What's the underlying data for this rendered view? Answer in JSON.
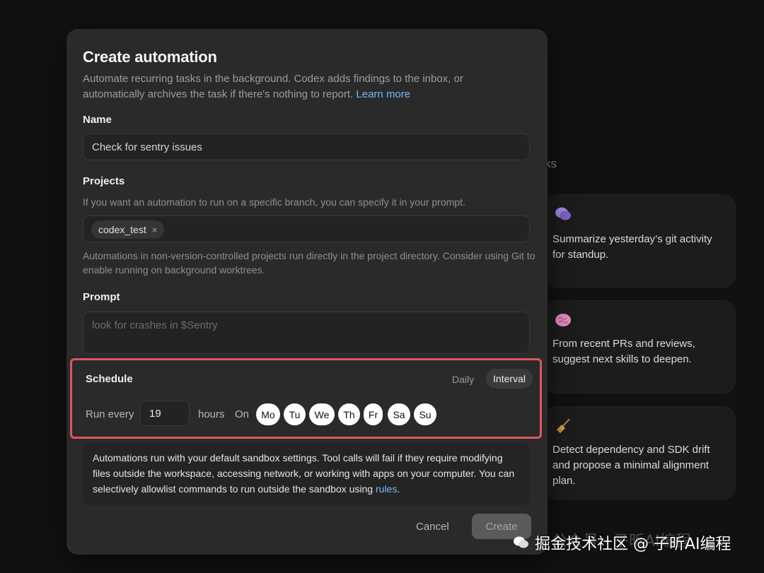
{
  "background": {
    "heading_partial": "ks",
    "cards": [
      {
        "icon": "speech-bubbles-icon",
        "text": "Summarize yesterday’s git activity for standup."
      },
      {
        "icon": "brain-icon",
        "text": "From recent PRs and reviews, suggest next skills to deepen."
      },
      {
        "icon": "broom-icon",
        "text": "Detect dependency and SDK drift and propose a minimal alignment plan."
      }
    ]
  },
  "modal": {
    "title": "Create automation",
    "description": "Automate recurring tasks in the background. Codex adds findings to the inbox, or automatically archives the task if there's nothing to report.",
    "learn_more": "Learn more",
    "name": {
      "label": "Name",
      "value": "Check for sentry issues"
    },
    "projects": {
      "label": "Projects",
      "hint": "If you want an automation to run on a specific branch, you can specify it in your prompt.",
      "chip": "codex_test",
      "chip_remove": "×",
      "note": "Automations in non-version-controlled projects run directly in the project directory. Consider using Git to enable running on background worktrees."
    },
    "prompt": {
      "label": "Prompt",
      "placeholder": "look for crashes in $Sentry"
    },
    "schedule": {
      "label": "Schedule",
      "toggle_daily": "Daily",
      "toggle_interval": "Interval",
      "selected_mode": "Interval",
      "run_every": "Run every",
      "interval_value": "19",
      "hours": "hours",
      "on": "On",
      "days": [
        "Mo",
        "Tu",
        "We",
        "Th",
        "Fr",
        "Sa",
        "Su"
      ]
    },
    "sandbox_info": "Automations run with your default sandbox settings. Tool calls will fail if they require modifying files outside the workspace, accessing network, or working with apps on your computer. You can selectively allowlist commands to run outside the sandbox using",
    "sandbox_rules_link": "rules",
    "sandbox_end": ".",
    "cancel": "Cancel",
    "create": "Create"
  },
  "watermark": {
    "text": "掘金技术社区 @ 子昕AI编程",
    "faint": "公众号 · 子昕AI编程"
  },
  "colors": {
    "highlight_border": "#e0565b",
    "link": "#79b8ff",
    "modal_bg": "#2a2a2a",
    "page_bg": "#111111"
  }
}
